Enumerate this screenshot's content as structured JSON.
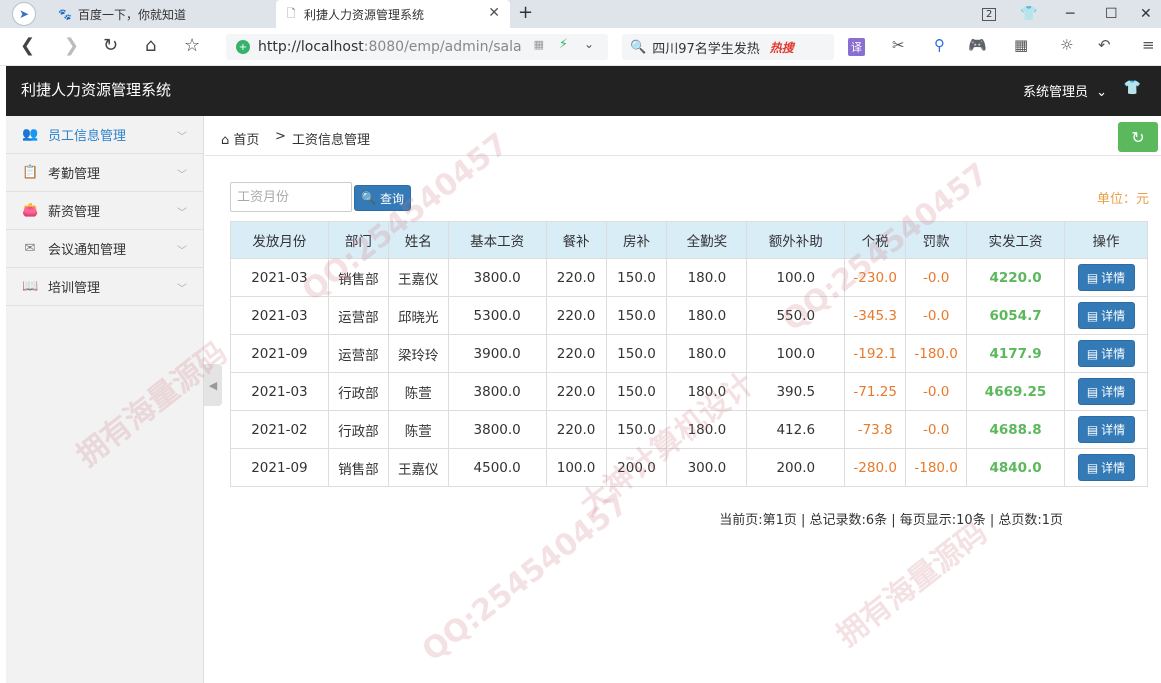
{
  "browser": {
    "tabs": [
      {
        "title": "百度一下，你就知道",
        "icon": "baidu-paw-icon"
      },
      {
        "title": "利捷人力资源管理系统",
        "icon": "document-icon"
      }
    ],
    "tab_count_badge": "2",
    "url_host": "http://localhost",
    "url_path": ":8080/emp/admin/sala",
    "search_text": "四川97名学生发热",
    "search_hot": "热搜",
    "translate_label": "译"
  },
  "app": {
    "title": "利捷人力资源管理系统",
    "admin_label": "系统管理员"
  },
  "sidebar": {
    "items": [
      {
        "label": "员工信息管理",
        "icon": "users-icon",
        "active": true
      },
      {
        "label": "考勤管理",
        "icon": "clipboard-icon",
        "active": false
      },
      {
        "label": "薪资管理",
        "icon": "wallet-icon",
        "active": false
      },
      {
        "label": "会议通知管理",
        "icon": "envelope-icon",
        "active": false
      },
      {
        "label": "培训管理",
        "icon": "book-icon",
        "active": false
      }
    ]
  },
  "breadcrumb": {
    "home": "首页",
    "separator": ">",
    "current": "工资信息管理"
  },
  "filters": {
    "month_placeholder": "工资月份",
    "query_label": "查询",
    "unit_label": "单位：元"
  },
  "table": {
    "headers": [
      "发放月份",
      "部门",
      "姓名",
      "基本工资",
      "餐补",
      "房补",
      "全勤奖",
      "额外补助",
      "个税",
      "罚款",
      "实发工资",
      "操作"
    ],
    "detail_label": "详情",
    "rows": [
      {
        "month": "2021-03",
        "dept": "销售部",
        "name": "王嘉仪",
        "base": "3800.0",
        "meal": "220.0",
        "housing": "150.0",
        "attendance": "180.0",
        "extra": "100.0",
        "tax": "-230.0",
        "fine": "-0.0",
        "actual": "4220.0"
      },
      {
        "month": "2021-03",
        "dept": "运营部",
        "name": "邱晓光",
        "base": "5300.0",
        "meal": "220.0",
        "housing": "150.0",
        "attendance": "180.0",
        "extra": "550.0",
        "tax": "-345.3",
        "fine": "-0.0",
        "actual": "6054.7"
      },
      {
        "month": "2021-09",
        "dept": "运营部",
        "name": "梁玲玲",
        "base": "3900.0",
        "meal": "220.0",
        "housing": "150.0",
        "attendance": "180.0",
        "extra": "100.0",
        "tax": "-192.1",
        "fine": "-180.0",
        "actual": "4177.9"
      },
      {
        "month": "2021-03",
        "dept": "行政部",
        "name": "陈萱",
        "base": "3800.0",
        "meal": "220.0",
        "housing": "150.0",
        "attendance": "180.0",
        "extra": "390.5",
        "tax": "-71.25",
        "fine": "-0.0",
        "actual": "4669.25"
      },
      {
        "month": "2021-02",
        "dept": "行政部",
        "name": "陈萱",
        "base": "3800.0",
        "meal": "220.0",
        "housing": "150.0",
        "attendance": "180.0",
        "extra": "412.6",
        "tax": "-73.8",
        "fine": "-0.0",
        "actual": "4688.8"
      },
      {
        "month": "2021-09",
        "dept": "销售部",
        "name": "王嘉仪",
        "base": "4500.0",
        "meal": "100.0",
        "housing": "200.0",
        "attendance": "300.0",
        "extra": "200.0",
        "tax": "-280.0",
        "fine": "-180.0",
        "actual": "4840.0"
      }
    ]
  },
  "pager": {
    "text": "当前页:第1页 | 总记录数:6条 | 每页显示:10条 | 总页数:1页"
  },
  "watermark": {
    "lines": [
      "QQ:254540457",
      "拥有海量源码",
      "大神计算机设计"
    ]
  },
  "colors": {
    "header_bg": "#222222",
    "sidebar_active": "#2d82c9",
    "table_header_bg": "#d9edf7",
    "primary_button": "#337ab7",
    "negative_value": "#e8792a",
    "actual_salary": "#5cb85c",
    "refresh_button": "#5cb85c",
    "unit_text": "#e8a04a"
  }
}
